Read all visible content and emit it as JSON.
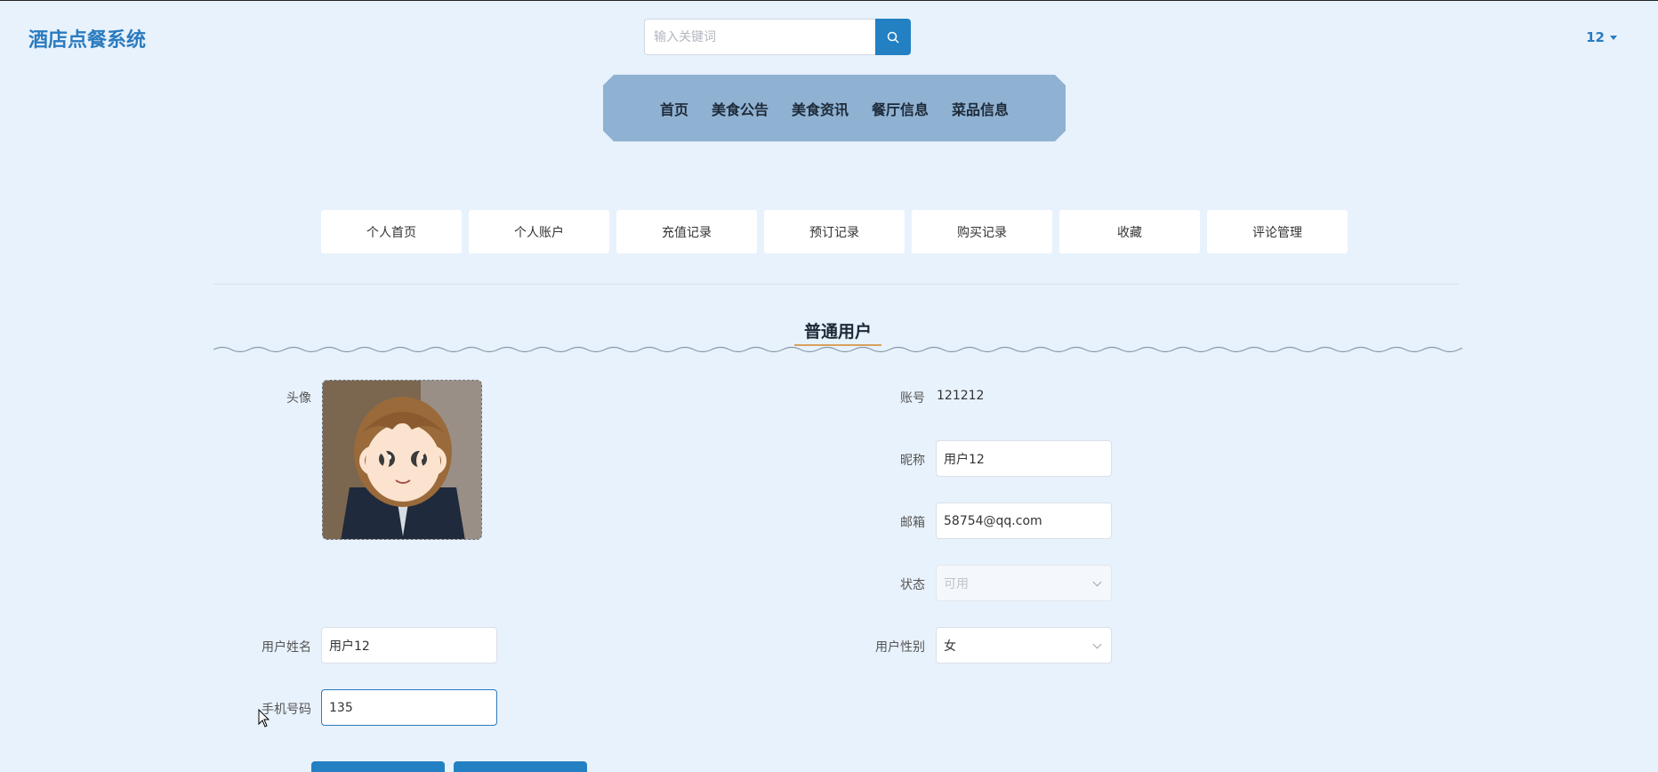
{
  "header": {
    "logo": "酒店点餐系统",
    "search_placeholder": "输入关键词",
    "user_name": "12"
  },
  "main_nav": [
    "首页",
    "美食公告",
    "美食资讯",
    "餐厅信息",
    "菜品信息"
  ],
  "sub_nav": [
    "个人首页",
    "个人账户",
    "充值记录",
    "预订记录",
    "购买记录",
    "收藏",
    "评论管理"
  ],
  "section_title": "普通用户",
  "form": {
    "avatar_label": "头像",
    "account_label": "账号",
    "account_value": "121212",
    "nickname_label": "昵称",
    "nickname_value": "用户12",
    "email_label": "邮箱",
    "email_value": "58754@qq.com",
    "status_label": "状态",
    "status_value": "可用",
    "name_label": "用户姓名",
    "name_value": "用户12",
    "gender_label": "用户性别",
    "gender_value": "女",
    "phone_label": "手机号码",
    "phone_value": "135"
  },
  "colors": {
    "background": "#e8f2fc",
    "accent": "#2280c3",
    "nav_bg": "#8fb2d3"
  }
}
